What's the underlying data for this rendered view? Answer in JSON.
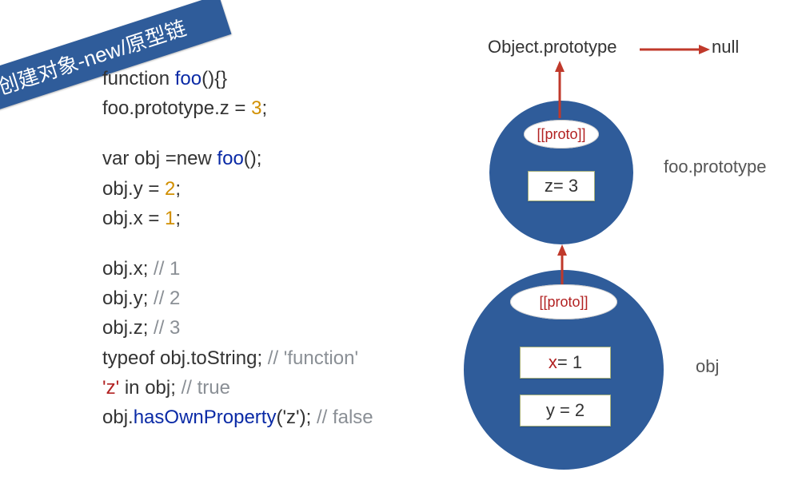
{
  "ribbon": {
    "title": "创建对象-new/原型链"
  },
  "code": {
    "l1": {
      "kw": "function",
      "fn": "foo",
      "tail": "(){}"
    },
    "l2": {
      "pre": "foo.prototype.z = ",
      "num": "3",
      "tail": ";"
    },
    "l3": {
      "pre": "var obj =new ",
      "fn": "foo",
      "tail": "();"
    },
    "l4": {
      "pre": "obj.y = ",
      "num": "2",
      "tail": ";"
    },
    "l5": {
      "pre": "obj.x = ",
      "num": "1",
      "tail": ";"
    },
    "l6": {
      "text": "obj.x; ",
      "comment": "// 1"
    },
    "l7": {
      "text": "obj.y; ",
      "comment": "// 2"
    },
    "l8": {
      "text": "obj.z; ",
      "comment": "// 3"
    },
    "l9": {
      "text": "typeof obj.toString; ",
      "comment": "//    'function'"
    },
    "l10": {
      "red": "'z'",
      "mid": " in obj; ",
      "comment": "// true"
    },
    "l11": {
      "pre": "obj.",
      "method": "hasOwnProperty",
      "args": "('z'); ",
      "comment": "// false"
    }
  },
  "diagram": {
    "topLeftLabel": "Object.prototype",
    "topRightLabel": "null",
    "fooPrototypeLabel": "foo.prototype",
    "objLabel": "obj",
    "protoPill": "[[proto]]",
    "z_box_name": "z",
    "z_box_eq": " = 3",
    "x_box_name": "x",
    "x_box_eq": " = 1",
    "y_box": "y = 2"
  }
}
